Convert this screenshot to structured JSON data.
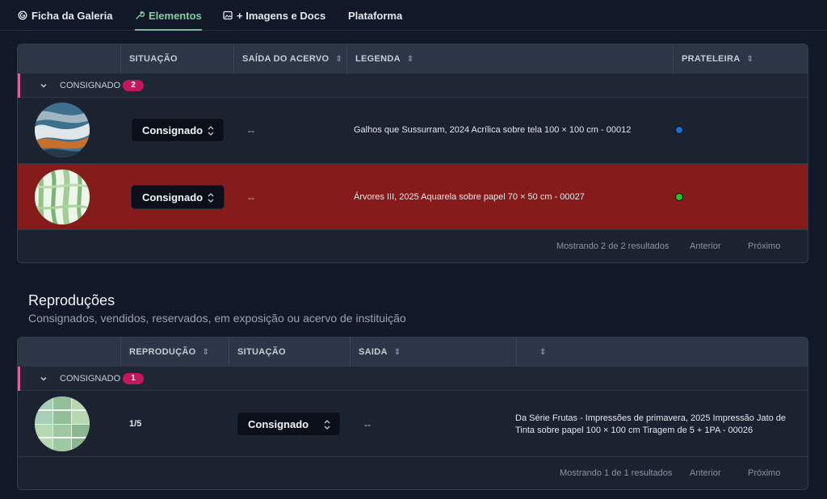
{
  "tabs": [
    {
      "label": "Ficha da Galeria",
      "icon": "gallery-icon",
      "active": false
    },
    {
      "label": "Elementos",
      "icon": "wrench-icon",
      "active": true
    },
    {
      "label": "+ Imagens e Docs",
      "icon": "image-docs-icon",
      "active": false
    },
    {
      "label": "Plataforma",
      "icon": "",
      "active": false
    }
  ],
  "consignados_table": {
    "headers": {
      "situacao": "SITUAÇÃO",
      "saida": "SAÍDA DO ACERVO",
      "legenda": "LEGENDA",
      "prateleira": "PRATELEIRA"
    },
    "group": {
      "label": "CONSIGNADO",
      "count": "2"
    },
    "rows": [
      {
        "status": "Consignado",
        "saida": "--",
        "legenda": "Galhos que Sussurram, 2024 Acrílica sobre tela 100 × 100 cm - 00012",
        "shelf_color": "#1a6fd6"
      },
      {
        "status": "Consignado",
        "saida": "--",
        "legenda": "Árvores III, 2025 Aquarela sobre papel 70 × 50 cm - 00027",
        "shelf_color": "#22c522"
      }
    ],
    "pager": {
      "summary": "Mostrando 2 de 2 resultados",
      "prev": "Anterior",
      "next": "Próximo"
    }
  },
  "reproducoes": {
    "title": "Reproduções",
    "subtitle": "Consignados, vendidos, reservados, em exposição ou acervo de instituição",
    "headers": {
      "reproducao": "REPRODUÇÃO",
      "situacao": "SITUAÇÃO",
      "saida": "SAIDA",
      "extra": ""
    },
    "group": {
      "label": "CONSIGNADO",
      "count": "1"
    },
    "rows": [
      {
        "reproducao": "1/5",
        "status": "Consignado",
        "saida": "--",
        "legenda": "Da Série Frutas - Impressões de primavera, 2025 Impressão Jato de Tinta sobre papel 100 × 100 cm Tiragem de 5 + 1PA - 00026"
      }
    ],
    "pager": {
      "summary": "Mostrando 1 de 1 resultados",
      "prev": "Anterior",
      "next": "Próximo"
    }
  },
  "colors": {
    "background": "#111827",
    "accent_green": "#86cfa6",
    "highlight_row": "#861b1b",
    "badge": "#c2185b",
    "group_bar": "#e05fa0"
  }
}
